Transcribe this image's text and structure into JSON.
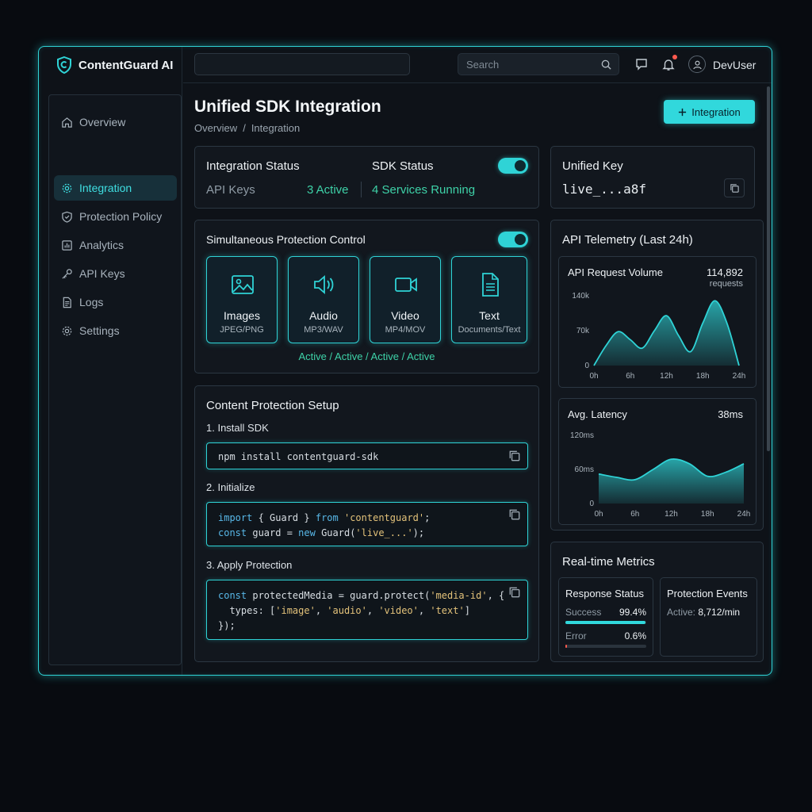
{
  "brand": {
    "name": "ContentGuard AI"
  },
  "sidebar": {
    "items": [
      {
        "label": "Overview",
        "icon": "home-icon",
        "active": false
      },
      {
        "label": "Integration",
        "icon": "gear-icon",
        "active": true
      },
      {
        "label": "Protection Policy",
        "icon": "shield-check-icon",
        "active": false
      },
      {
        "label": "Analytics",
        "icon": "bar-chart-icon",
        "active": false
      },
      {
        "label": "API Keys",
        "icon": "key-icon",
        "active": false
      },
      {
        "label": "Logs",
        "icon": "document-icon",
        "active": false
      },
      {
        "label": "Settings",
        "icon": "settings-icon",
        "active": false
      }
    ]
  },
  "topbar": {
    "search_placeholder": "Search",
    "username": "DevUser"
  },
  "page": {
    "title": "Unified SDK Integration",
    "breadcrumb": [
      "Overview",
      "/",
      "Integration"
    ],
    "primary_button": "Integration"
  },
  "status_card": {
    "integration_title": "Integration Status",
    "api_keys_label": "API Keys",
    "api_keys_value": "3 Active",
    "sdk_title": "SDK Status",
    "sdk_value": "4 Services Running",
    "sdk_enabled": true
  },
  "key_card": {
    "title": "Unified Key",
    "value": "live_...a8f"
  },
  "protection_control": {
    "title": "Simultaneous Protection Control",
    "enabled": true,
    "types": [
      {
        "name": "Images",
        "formats": "JPEG/PNG",
        "icon": "image-icon"
      },
      {
        "name": "Audio",
        "formats": "MP3/WAV",
        "icon": "speaker-icon"
      },
      {
        "name": "Video",
        "formats": "MP4/MOV",
        "icon": "video-camera-icon"
      },
      {
        "name": "Text",
        "formats": "Documents/Text",
        "icon": "text-document-icon"
      }
    ],
    "status_line": "Active / Active / Active / Active"
  },
  "setup": {
    "title": "Content Protection Setup",
    "steps": [
      {
        "label": "1. Install SDK",
        "code": [
          "npm install contentguard-sdk"
        ]
      },
      {
        "label": "2. Initialize",
        "code": [
          "import { Guard } from 'contentguard';",
          "const guard = new Guard('live_...');"
        ]
      },
      {
        "label": "3. Apply Protection",
        "code": [
          "const protectedMedia = guard.protect('media-id', {",
          "  types: ['image', 'audio', 'video', 'text']",
          "});"
        ]
      }
    ]
  },
  "telemetry": {
    "title": "API Telemetry (Last 24h)",
    "volume": {
      "label": "API Request Volume",
      "total": "114,892",
      "unit": "requests"
    },
    "latency": {
      "label": "Avg. Latency",
      "value": "38ms"
    }
  },
  "chart_data": [
    {
      "type": "area",
      "title": "API Request Volume",
      "x": [
        0,
        2,
        4,
        6,
        8,
        10,
        12,
        14,
        16,
        18,
        20,
        22,
        24
      ],
      "x_ticks": [
        "0h",
        "6h",
        "12h",
        "18h",
        "24h"
      ],
      "y_ticks": [
        "0",
        "70k",
        "140k"
      ],
      "ylim": [
        0,
        140000
      ],
      "values": [
        0,
        40000,
        68000,
        52000,
        35000,
        70000,
        100000,
        60000,
        28000,
        85000,
        130000,
        85000,
        0
      ],
      "color": "#2fd3d6"
    },
    {
      "type": "area",
      "title": "Avg. Latency",
      "x": [
        0,
        3,
        6,
        9,
        12,
        15,
        18,
        21,
        24
      ],
      "x_ticks": [
        "0h",
        "6h",
        "12h",
        "18h",
        "24h"
      ],
      "y_ticks": [
        "0",
        "60ms",
        "120ms"
      ],
      "ylim": [
        0,
        120
      ],
      "values": [
        52,
        46,
        42,
        60,
        78,
        70,
        48,
        55,
        70
      ],
      "color": "#2fd3d6"
    }
  ],
  "metrics": {
    "title": "Real-time Metrics",
    "response_title": "Response Status",
    "success_label": "Success",
    "success_value": "99.4%",
    "success_fraction": 0.994,
    "error_label": "Error",
    "error_value": "0.6%",
    "error_fraction": 0.006,
    "events_title": "Protection Events",
    "events_label": "Active:",
    "events_value": "8,712/min"
  },
  "colors": {
    "accent": "#2fd3d6",
    "success_text": "#3ed2a8",
    "background": "#080b10"
  }
}
